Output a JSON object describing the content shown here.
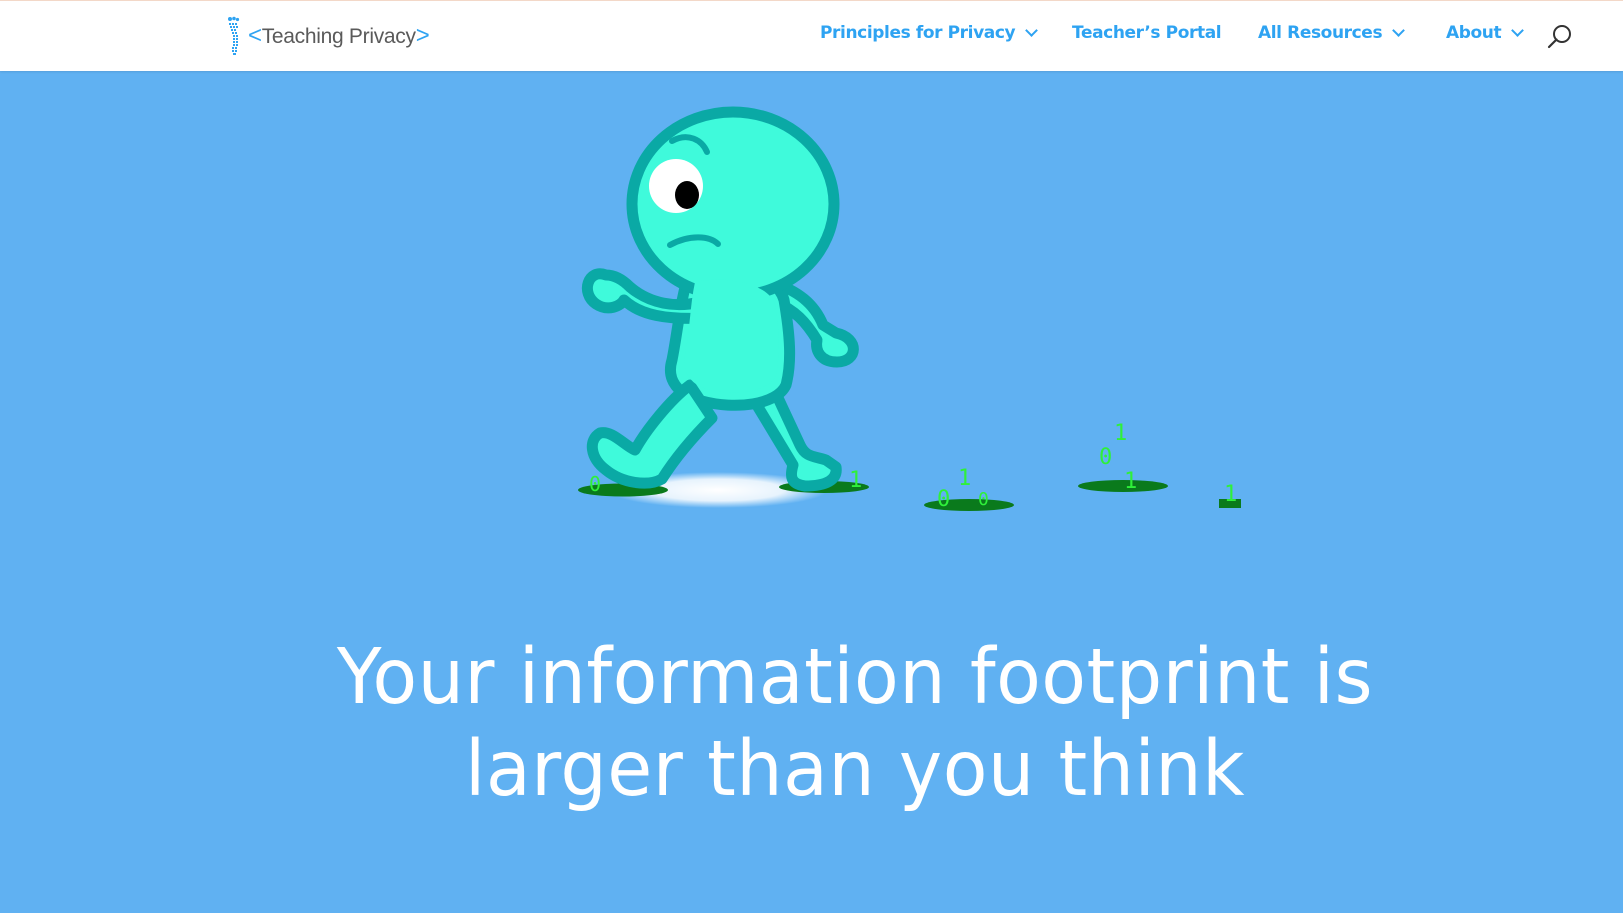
{
  "header": {
    "logo": {
      "open_bracket": "<",
      "word1_initial": "T",
      "word1_rest": "eaching ",
      "word2_initial": "P",
      "word2_rest": "rivacy",
      "close_bracket": ">",
      "icon": "footprint-icon"
    },
    "nav": [
      {
        "label": "Principles for Privacy",
        "has_dropdown": true,
        "icon": "chevron-down-icon"
      },
      {
        "label": "Teacher’s Portal",
        "has_dropdown": false
      },
      {
        "label": "All Resources",
        "has_dropdown": true,
        "icon": "chevron-down-icon"
      },
      {
        "label": "About",
        "has_dropdown": true,
        "icon": "chevron-down-icon"
      }
    ],
    "search_icon": "search-icon"
  },
  "hero": {
    "illustration": {
      "character": "walking-cartoon-figure",
      "footprint_digits": [
        "0",
        "1",
        "0",
        "1",
        "0",
        "0",
        "1",
        "1",
        "1"
      ]
    },
    "headline_line1": "Your information footprint is",
    "headline_line2": "larger than you think"
  },
  "colors": {
    "background": "#60b1f2",
    "header_bg": "#ffffff",
    "nav_text": "#2ea3f2",
    "character_fill": "#3ffadb",
    "character_outline": "#0aa9a5",
    "footprint": "#0a7a1c",
    "digits": "#2ff03a",
    "headline": "#ffffff"
  }
}
